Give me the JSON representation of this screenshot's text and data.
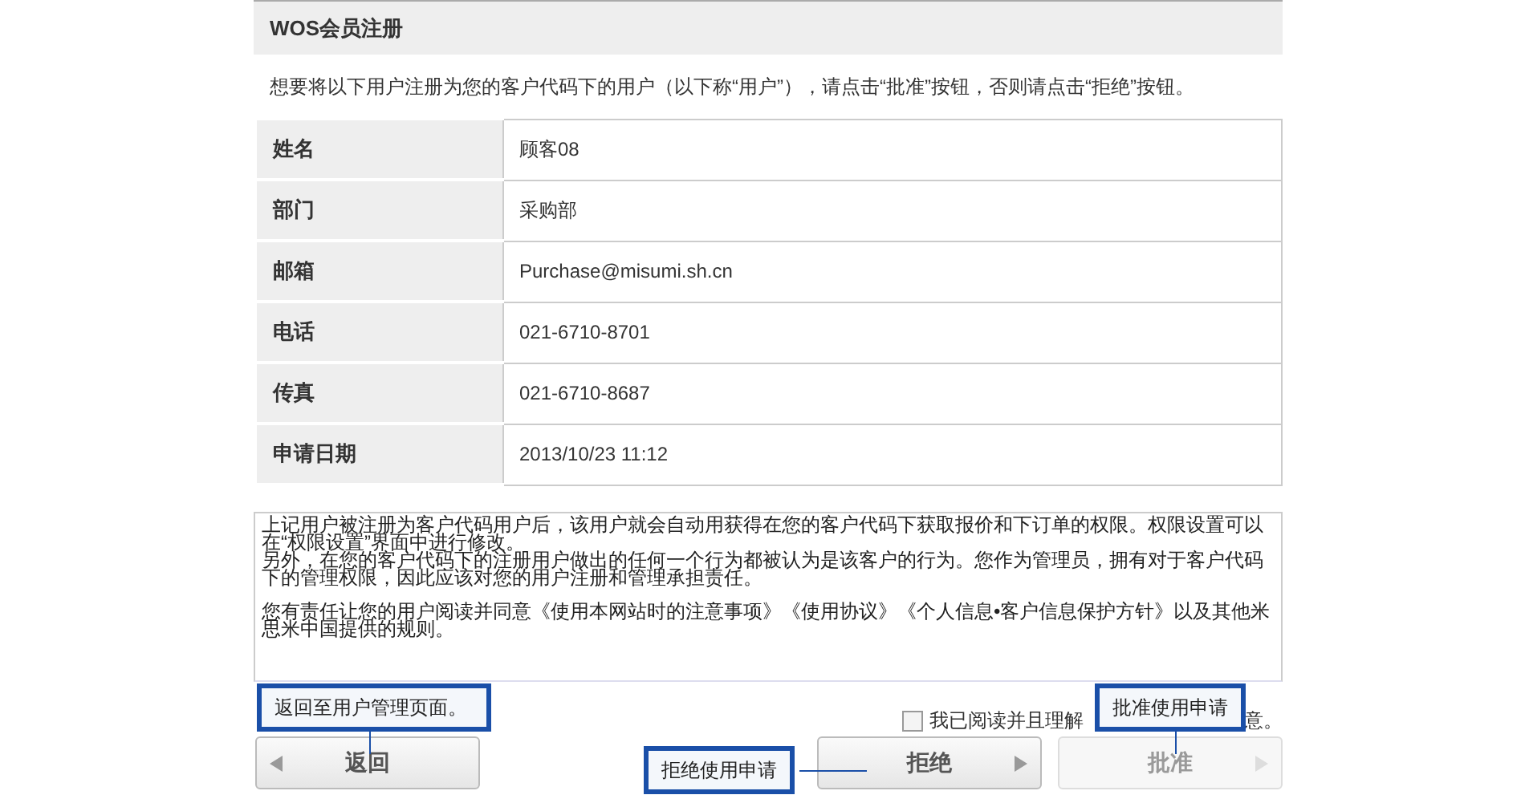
{
  "header": {
    "title": "WOS会员注册"
  },
  "intro": "想要将以下用户注册为您的客户代码下的用户（以下称“用户”），请点击“批准”按钮，否则请点击“拒绝”按钮。",
  "details": [
    {
      "label": "姓名",
      "value": "顾客08"
    },
    {
      "label": "部门",
      "value": "采购部"
    },
    {
      "label": "邮箱",
      "value": "Purchase@misumi.sh.cn"
    },
    {
      "label": "电话",
      "value": "021-6710-8701"
    },
    {
      "label": "传真",
      "value": "021-6710-8687"
    },
    {
      "label": "申请日期",
      "value": "2013/10/23 11:12"
    }
  ],
  "notice": [
    "上记用户被注册为客户代码用户后，该用户就会自动用获得在您的客户代码下获取报价和下订单的权限。权限设置可以在“权限设置”界面中进行修改。",
    "另外，在您的客户代码下的注册用户做出的任何一个行为都被认为是该客户的行为。您作为管理员，拥有对于客户代码下的管理权限，因此应该对您的用户注册和管理承担责任。",
    "您有责任让您的用户阅读并同意《使用本网站时的注意事项》《使用协议》《个人信息•客户信息保护方针》以及其他米思米中国提供的规则。"
  ],
  "agreement": {
    "checked": false,
    "label": "我已阅读并且理解",
    "label_tail": "意。"
  },
  "buttons": [
    {
      "kind": "back",
      "label": "返回",
      "disabled": false
    },
    {
      "kind": "reject",
      "label": "拒绝",
      "disabled": false
    },
    {
      "kind": "approve",
      "label": "批准",
      "disabled": true
    }
  ],
  "callouts": [
    {
      "text": "返回至用户管理页面。"
    },
    {
      "text": "拒绝使用申请"
    },
    {
      "text": "批准使用申请"
    }
  ]
}
